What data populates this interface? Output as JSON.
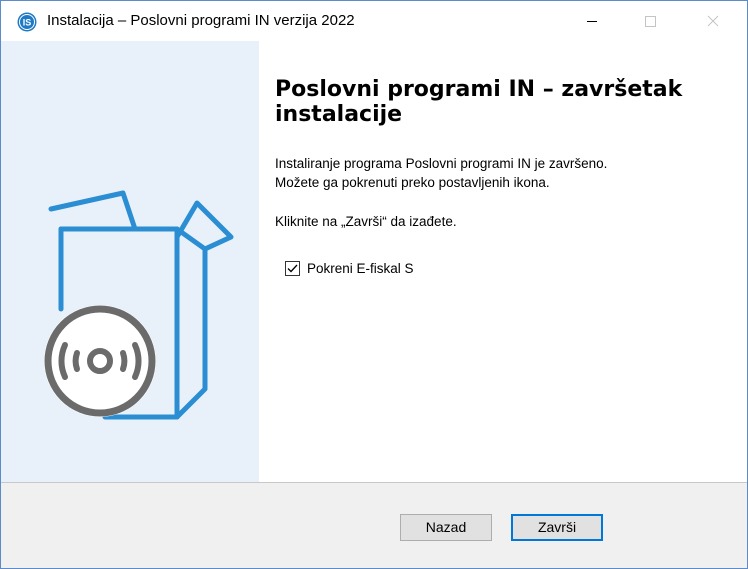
{
  "window": {
    "title": "Instalacija – Poslovni programi IN verzija 2022",
    "app_icon_text": "IS",
    "brand_color": "#1f7ac6"
  },
  "wizard": {
    "heading": "Poslovni programi IN – završetak instalacije",
    "line1": "Instaliranje programa Poslovni programi IN je završeno.",
    "line2": "Možete ga pokrenuti preko postavljenih ikona.",
    "line3": "Kliknite na „Završi“ da izađete.",
    "checkbox_label": "Pokreni E-fiskal S",
    "checkbox_checked": true
  },
  "footer": {
    "back_label": "Nazad",
    "finish_label": "Završi"
  },
  "colors": {
    "side_panel": "#e8f1fa",
    "box_outline": "#2b8ed3",
    "disc": "#6b6b6b",
    "focus_border": "#0078d7"
  }
}
